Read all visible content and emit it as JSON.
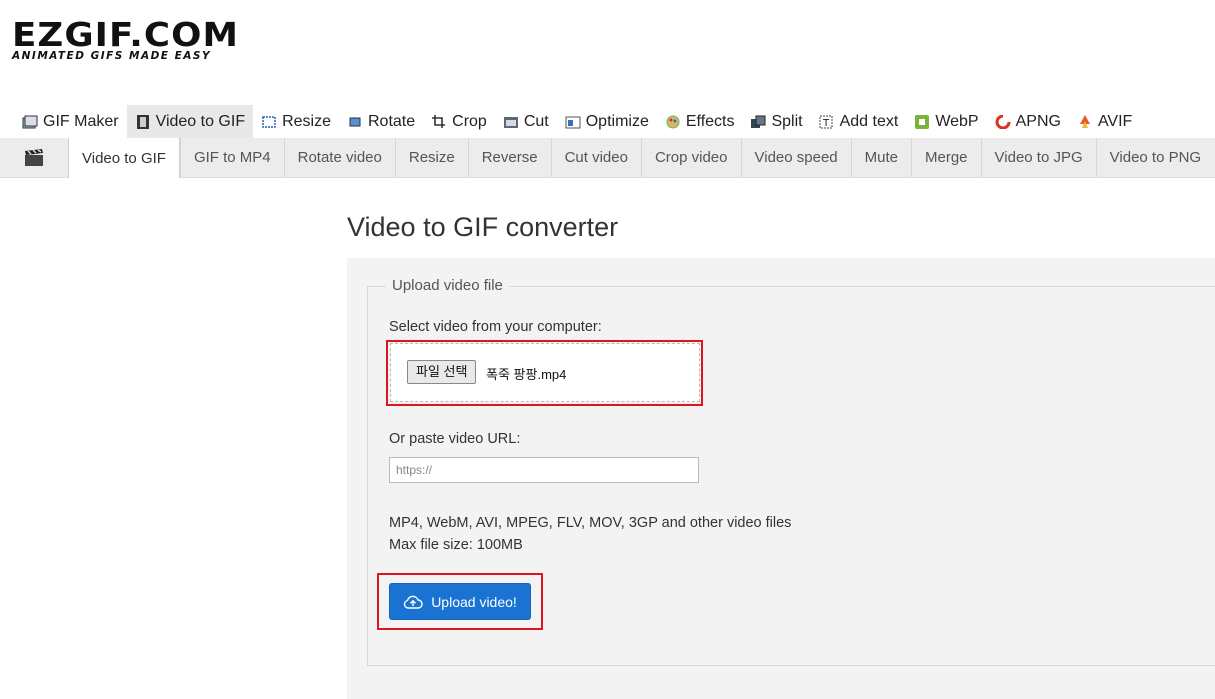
{
  "logo": {
    "main": "EZGIF.COM",
    "tagline": "ANIMATED GIFS MADE EASY"
  },
  "topnav": [
    {
      "label": "GIF Maker",
      "icon": "gif-maker-icon"
    },
    {
      "label": "Video to GIF",
      "icon": "film-icon",
      "active": true
    },
    {
      "label": "Resize",
      "icon": "resize-icon"
    },
    {
      "label": "Rotate",
      "icon": "rotate-icon"
    },
    {
      "label": "Crop",
      "icon": "crop-icon"
    },
    {
      "label": "Cut",
      "icon": "cut-icon"
    },
    {
      "label": "Optimize",
      "icon": "optimize-icon"
    },
    {
      "label": "Effects",
      "icon": "effects-icon"
    },
    {
      "label": "Split",
      "icon": "split-icon"
    },
    {
      "label": "Add text",
      "icon": "add-text-icon"
    },
    {
      "label": "WebP",
      "icon": "webp-icon"
    },
    {
      "label": "APNG",
      "icon": "apng-icon"
    },
    {
      "label": "AVIF",
      "icon": "avif-icon"
    }
  ],
  "subnav": [
    {
      "label": "Video to GIF",
      "active": true
    },
    {
      "label": "GIF to MP4"
    },
    {
      "label": "Rotate video"
    },
    {
      "label": "Resize"
    },
    {
      "label": "Reverse"
    },
    {
      "label": "Cut video"
    },
    {
      "label": "Crop video"
    },
    {
      "label": "Video speed"
    },
    {
      "label": "Mute"
    },
    {
      "label": "Merge"
    },
    {
      "label": "Video to JPG"
    },
    {
      "label": "Video to PNG"
    }
  ],
  "main": {
    "title": "Video to GIF converter",
    "legend": "Upload video file",
    "select_label": "Select video from your computer:",
    "file_button": "파일 선택",
    "file_name": "폭죽 팡팡.mp4",
    "url_label": "Or paste video URL:",
    "url_placeholder": "https://",
    "formats": "MP4, WebM, AVI, MPEG, FLV, MOV, 3GP and other video files",
    "max_size": "Max file size: 100MB",
    "upload_button": "Upload video!"
  },
  "colors": {
    "accent": "#1a73d3",
    "highlight": "#e0141e",
    "subnav_bg": "#ececec",
    "panel_bg": "#f3f3f3"
  }
}
